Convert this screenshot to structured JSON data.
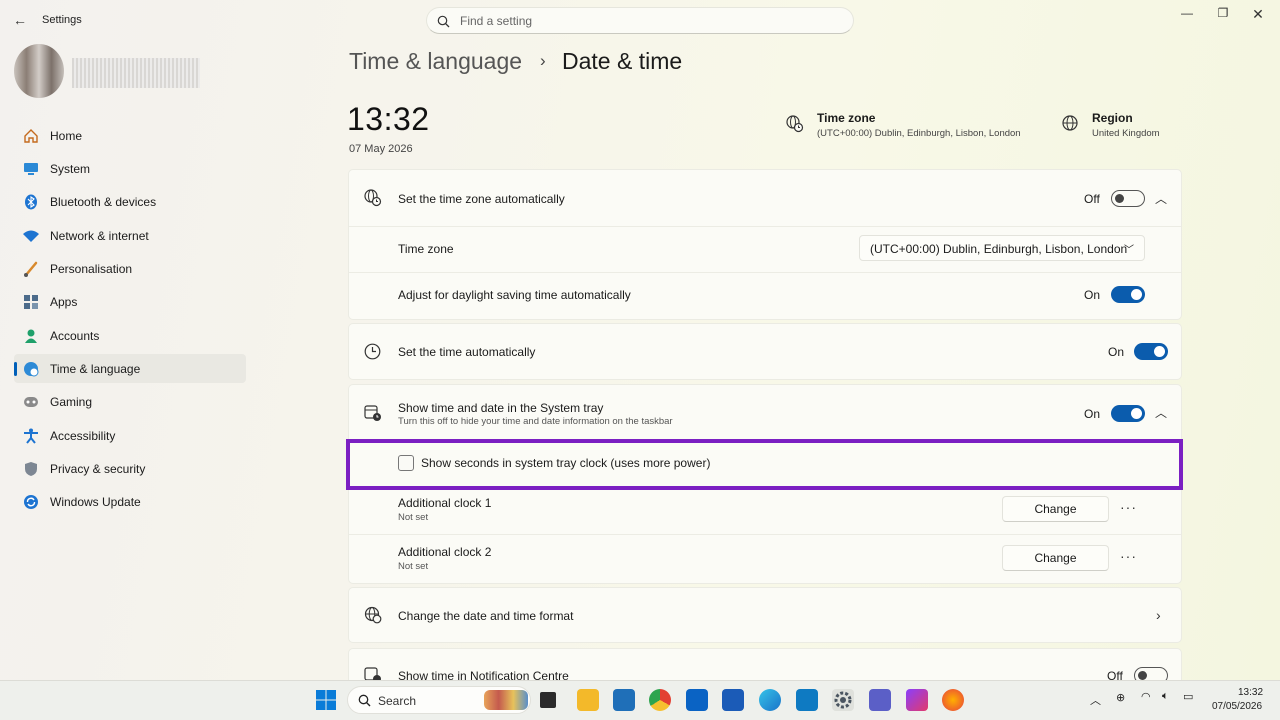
{
  "window": {
    "title": "Settings"
  },
  "search": {
    "placeholder": "Find a setting"
  },
  "sidebar": {
    "items": [
      {
        "label": "Home"
      },
      {
        "label": "System"
      },
      {
        "label": "Bluetooth & devices"
      },
      {
        "label": "Network & internet"
      },
      {
        "label": "Personalisation"
      },
      {
        "label": "Apps"
      },
      {
        "label": "Accounts"
      },
      {
        "label": "Time & language"
      },
      {
        "label": "Gaming"
      },
      {
        "label": "Accessibility"
      },
      {
        "label": "Privacy & security"
      },
      {
        "label": "Windows Update"
      }
    ],
    "selected": "Time & language"
  },
  "breadcrumb": {
    "parent": "Time & language",
    "separator": "›",
    "current": "Date & time"
  },
  "clock": {
    "time": "13:32",
    "date": "07 May 2026"
  },
  "timezone_info": {
    "title": "Time zone",
    "value": "(UTC+00:00) Dublin, Edinburgh, Lisbon, London"
  },
  "region_info": {
    "title": "Region",
    "value": "United Kingdom"
  },
  "settings": {
    "auto_timezone": {
      "label": "Set the time zone automatically",
      "state": "Off"
    },
    "time_zone": {
      "label": "Time zone",
      "value": "(UTC+00:00) Dublin, Edinburgh, Lisbon, London"
    },
    "daylight": {
      "label": "Adjust for daylight saving time automatically",
      "state": "On"
    },
    "auto_time": {
      "label": "Set the time automatically",
      "state": "On"
    },
    "system_tray": {
      "label": "Show time and date in the System tray",
      "sub": "Turn this off to hide your time and date information on the taskbar",
      "state": "On"
    },
    "show_seconds": {
      "label": "Show seconds in system tray clock (uses more power)",
      "checked": false
    },
    "clock1": {
      "label": "Additional clock 1",
      "sub": "Not set",
      "button": "Change"
    },
    "clock2": {
      "label": "Additional clock 2",
      "sub": "Not set",
      "button": "Change"
    },
    "format": {
      "label": "Change the date and time format"
    },
    "notification": {
      "label": "Show time in Notification Centre",
      "state": "Off"
    }
  },
  "taskbar": {
    "search_label": "Search",
    "time": "13:32",
    "date": "07/05/2026"
  },
  "colors": {
    "accent": "#0b5cad",
    "highlight": "#7b1fc2"
  }
}
